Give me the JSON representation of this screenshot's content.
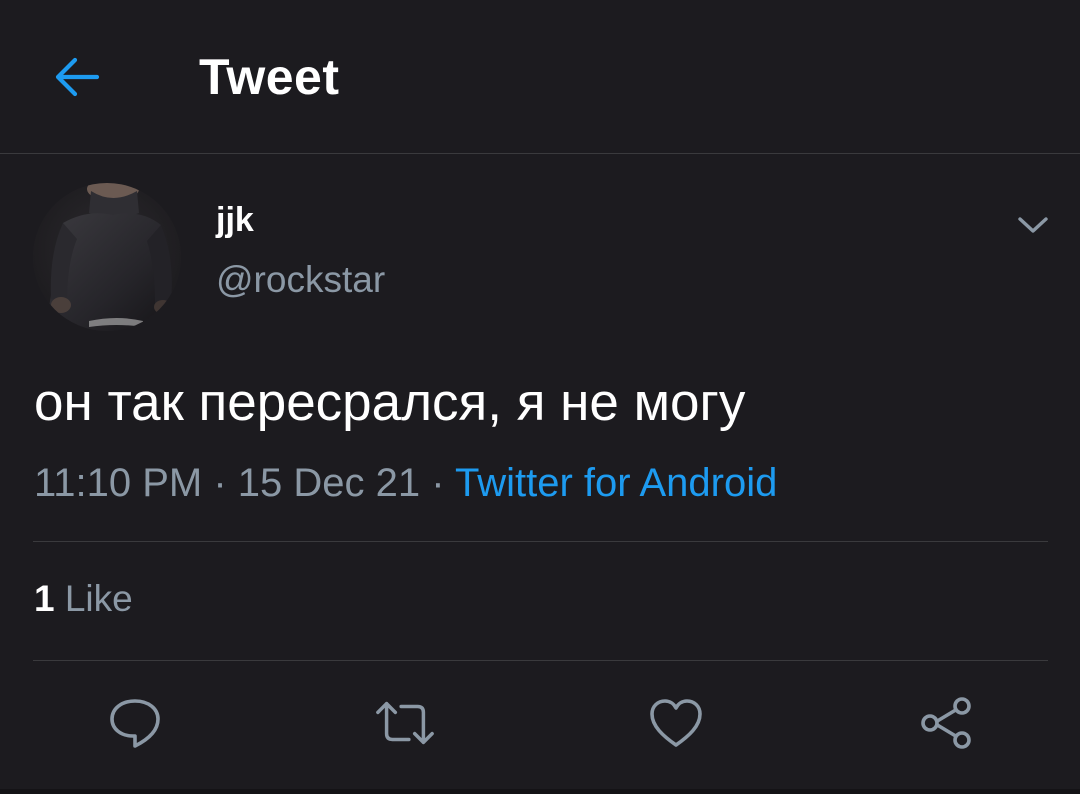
{
  "header": {
    "title": "Tweet",
    "back_icon": "arrow-left-icon"
  },
  "author": {
    "display_name": "jjk",
    "handle": "@rockstar",
    "avatar": "avatar-photo-dark-turtleneck",
    "menu_icon": "chevron-down-icon"
  },
  "tweet": {
    "text": "он так пересрался, я не могу",
    "time": "11:10 PM",
    "separator": " · ",
    "date": "15 Dec 21",
    "source": "Twitter for Android"
  },
  "stats": {
    "like_count": "1",
    "like_label": "Like"
  },
  "actions": [
    {
      "name": "reply",
      "icon": "speech-bubble-icon"
    },
    {
      "name": "retweet",
      "icon": "retweet-icon"
    },
    {
      "name": "like",
      "icon": "heart-icon"
    },
    {
      "name": "share",
      "icon": "share-icon"
    }
  ],
  "colors": {
    "background": "#1c1b1f",
    "accent": "#1d9bf0",
    "secondary_text": "#8b98a5",
    "divider": "#3a3a3d"
  }
}
